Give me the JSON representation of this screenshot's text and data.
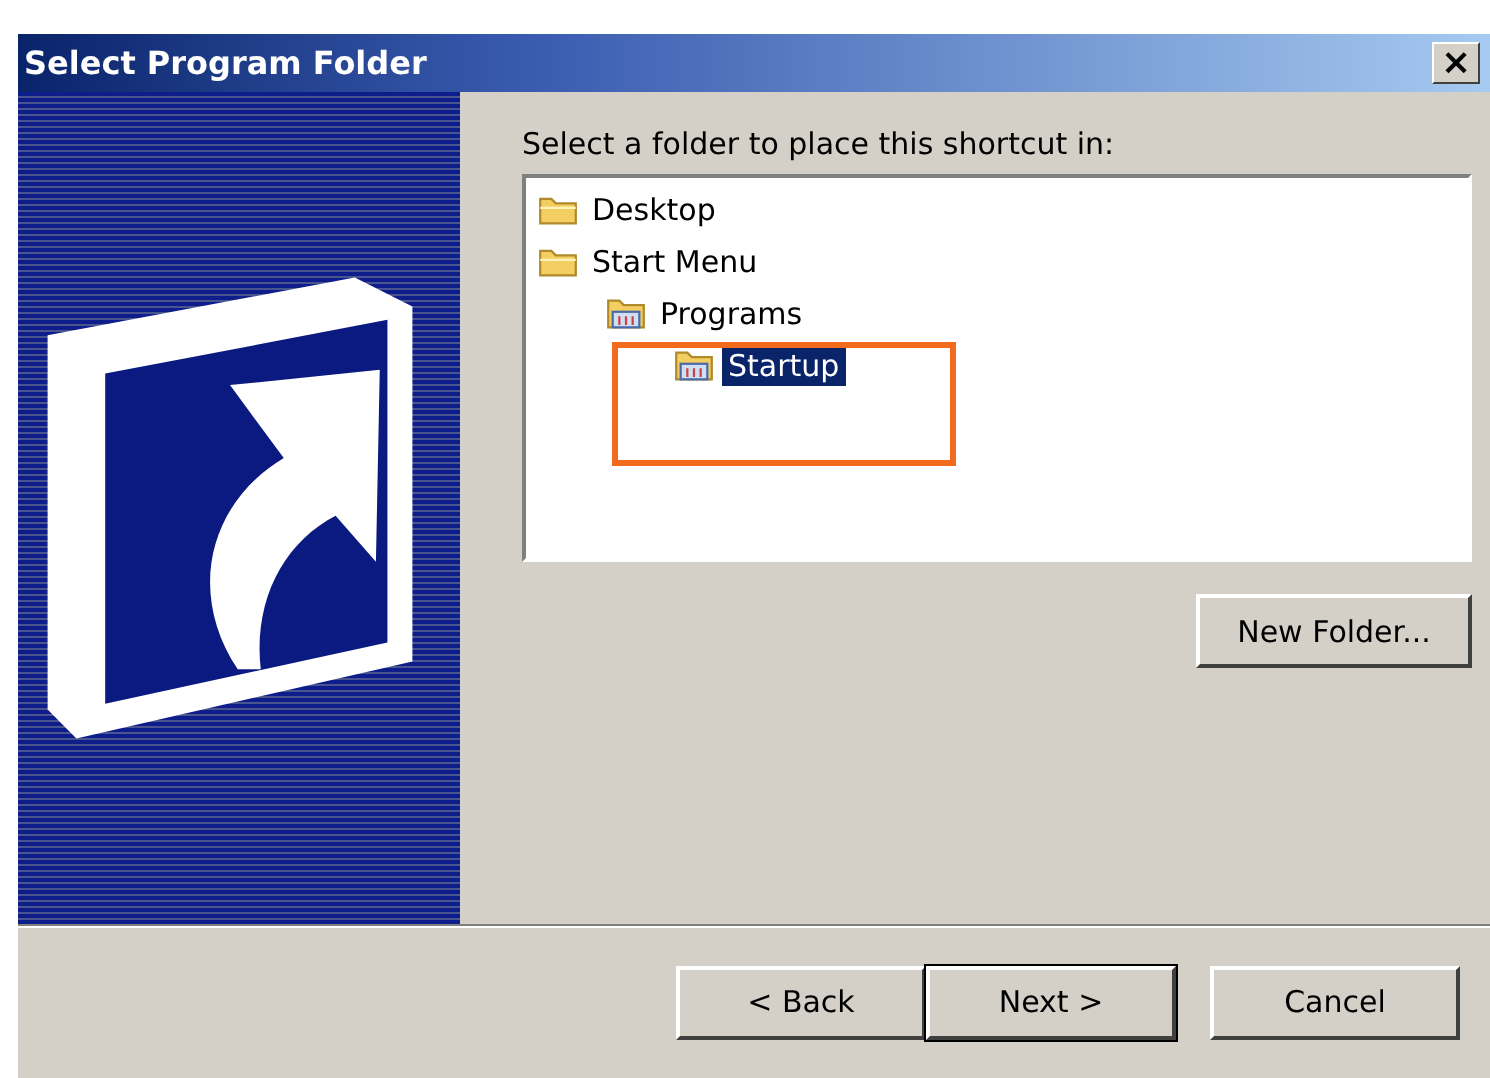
{
  "window": {
    "title": "Select Program Folder",
    "close": "×"
  },
  "prompt": "Select a folder to place this shortcut in:",
  "tree": [
    {
      "label": "Desktop",
      "kind": "folder",
      "selected": false
    },
    {
      "label": "Start Menu",
      "kind": "folder",
      "selected": false,
      "children": [
        {
          "label": "Programs",
          "kind": "programs",
          "selected": false,
          "children": [
            {
              "label": "Startup",
              "kind": "programs",
              "selected": true
            }
          ]
        }
      ]
    }
  ],
  "new_folder_button": "New Folder...",
  "buttons": [
    {
      "label": "< Back",
      "default": false
    },
    {
      "label": "Next >",
      "default": true
    },
    {
      "label": "Cancel",
      "default": false
    }
  ]
}
